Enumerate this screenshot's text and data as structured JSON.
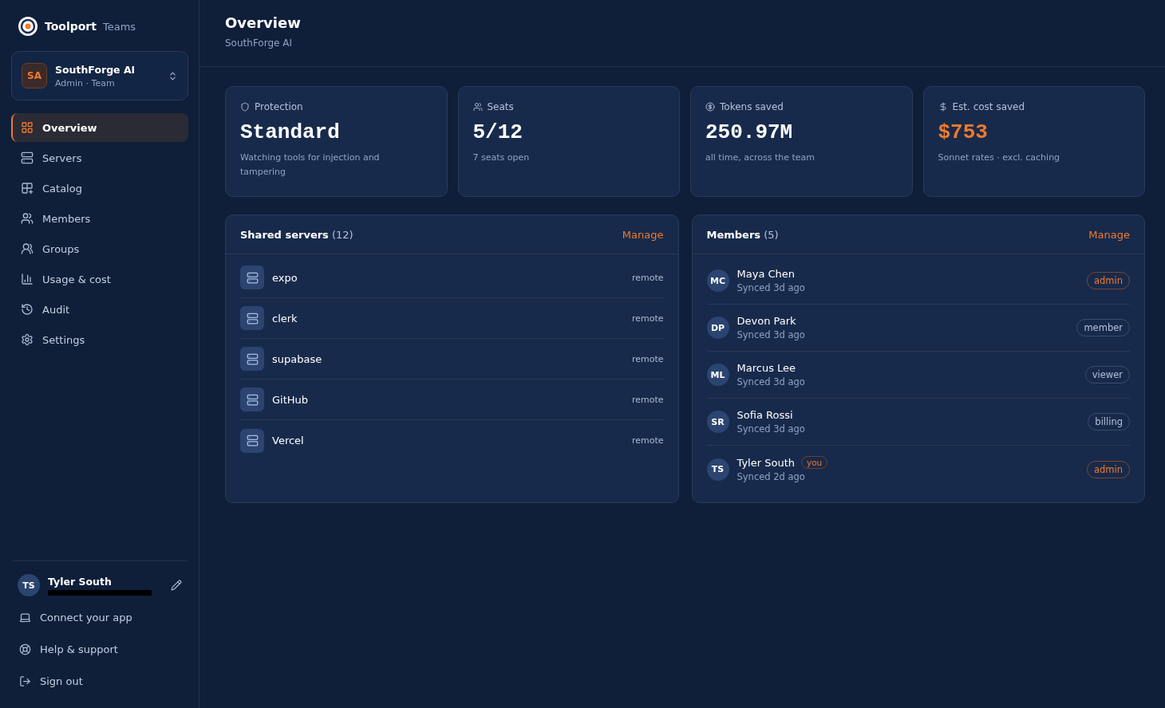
{
  "brand": {
    "name": "Toolport",
    "suffix": "Teams"
  },
  "workspace": {
    "initials": "SA",
    "name": "SouthForge AI",
    "role": "Admin · Team"
  },
  "nav": [
    {
      "label": "Overview",
      "selected": true
    },
    {
      "label": "Servers",
      "selected": false
    },
    {
      "label": "Catalog",
      "selected": false
    },
    {
      "label": "Members",
      "selected": false
    },
    {
      "label": "Groups",
      "selected": false
    },
    {
      "label": "Usage & cost",
      "selected": false
    },
    {
      "label": "Audit",
      "selected": false
    },
    {
      "label": "Settings",
      "selected": false
    }
  ],
  "user": {
    "initials": "TS",
    "name": "Tyler South"
  },
  "footer_links": [
    "Connect your app",
    "Help & support",
    "Sign out"
  ],
  "header": {
    "title": "Overview",
    "subtitle": "SouthForge AI"
  },
  "stats": [
    {
      "label": "Protection",
      "value": "Standard",
      "note": "Watching tools for injection and tampering",
      "accent": false
    },
    {
      "label": "Seats",
      "value": "5/12",
      "note": "7 seats open",
      "accent": false
    },
    {
      "label": "Tokens saved",
      "value": "250.97M",
      "note": "all time, across the team",
      "accent": false
    },
    {
      "label": "Est. cost saved",
      "value": "$753",
      "note": "Sonnet rates · excl. caching",
      "accent": true
    }
  ],
  "servers_panel": {
    "title": "Shared servers",
    "count": "(12)",
    "action": "Manage",
    "servers": [
      {
        "name": "expo",
        "type": "remote"
      },
      {
        "name": "clerk",
        "type": "remote"
      },
      {
        "name": "supabase",
        "type": "remote"
      },
      {
        "name": "GitHub",
        "type": "remote"
      },
      {
        "name": "Vercel",
        "type": "remote"
      }
    ]
  },
  "members_panel": {
    "title": "Members",
    "count": "(5)",
    "action": "Manage",
    "members": [
      {
        "initials": "MC",
        "name": "Maya Chen",
        "synced": "Synced 3d ago",
        "role": "admin",
        "accent": true
      },
      {
        "initials": "DP",
        "name": "Devon Park",
        "synced": "Synced 3d ago",
        "role": "member",
        "accent": false
      },
      {
        "initials": "ML",
        "name": "Marcus Lee",
        "synced": "Synced 3d ago",
        "role": "viewer",
        "accent": false
      },
      {
        "initials": "SR",
        "name": "Sofia Rossi",
        "synced": "Synced 3d ago",
        "role": "billing",
        "accent": false
      },
      {
        "initials": "TS",
        "name": "Tyler South",
        "you": "you",
        "synced": "Synced 2d ago",
        "role": "admin",
        "accent": true
      }
    ]
  }
}
